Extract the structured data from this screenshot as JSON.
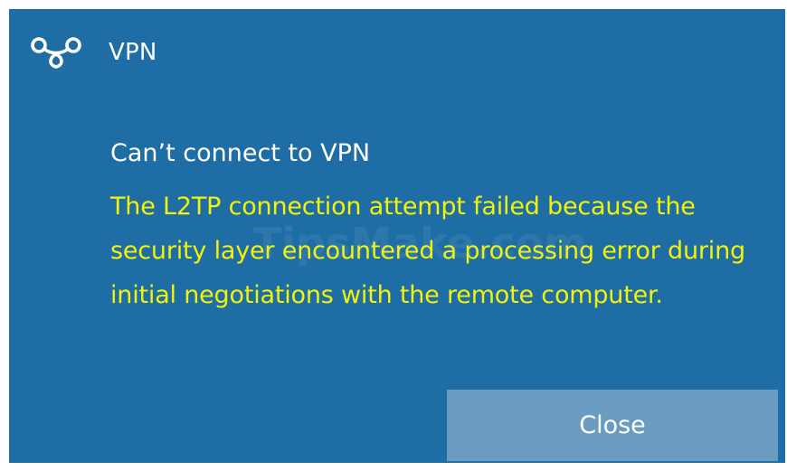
{
  "app": {
    "name": "VPN",
    "icon": "vpn-icon",
    "background_color": "#1f6da5",
    "watermark": "TipsMake.com"
  },
  "notification": {
    "title": "Can’t connect to VPN",
    "message": "The L2TP connection attempt failed because the security layer encountered a processing error during initial negotiations with the remote computer.",
    "message_color": "#f2f20a"
  },
  "actions": {
    "close_label": "Close",
    "close_color": "#6a9bc1"
  }
}
